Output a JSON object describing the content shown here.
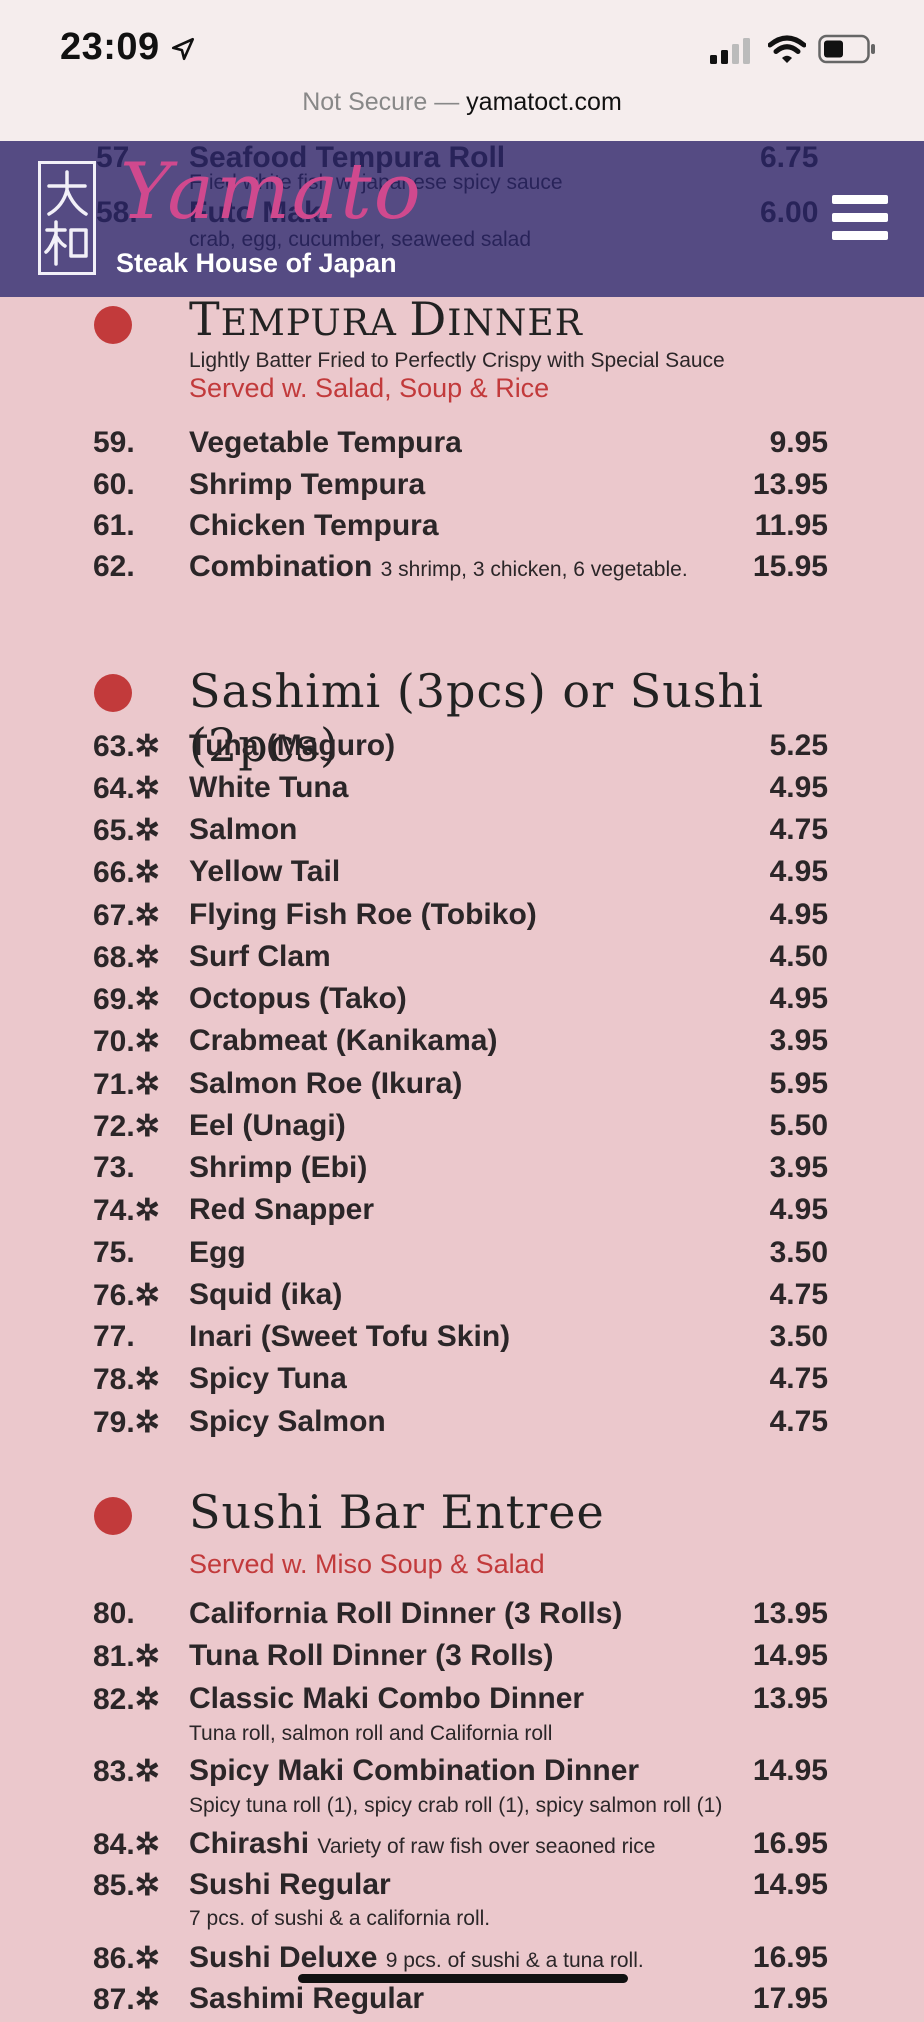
{
  "status_bar": {
    "time": "23:09",
    "url_prefix": "Not Secure — ",
    "url_host": "yamatoct.com"
  },
  "header": {
    "logo_script": "Yamato",
    "logo_subtitle": "Steak House of Japan",
    "under_rows": [
      {
        "num": "57.",
        "name": "Seafood Tempura Roll",
        "price": "6.75",
        "desc": "Fried white fish w. japanese spicy sauce"
      },
      {
        "num": "58.",
        "name": "Futo Maki",
        "price": "6.00",
        "desc": "crab, egg, cucumber, seaweed salad"
      }
    ],
    "menu_icon": "hamburger-menu-icon"
  },
  "sections": {
    "tempura": {
      "title_a": "T",
      "title_b": "EMPURA ",
      "title_c": "D",
      "title_d": "INNER",
      "subtitle": "Lightly Batter Fried to Perfectly Crispy with Special Sauce",
      "served": "Served w. Salad, Soup & Rice",
      "items": [
        {
          "num": "59.",
          "name": "Vegetable Tempura",
          "note": "",
          "price": "9.95"
        },
        {
          "num": "60.",
          "name": "Shrimp Tempura",
          "note": "",
          "price": "13.95"
        },
        {
          "num": "61.",
          "name": "Chicken Tempura",
          "note": "",
          "price": "11.95"
        },
        {
          "num": "62.",
          "name": "Combination ",
          "note": "3 shrimp, 3 chicken, 6 vegetable.",
          "price": "15.95"
        }
      ]
    },
    "sashimi": {
      "title": "Sashimi (3pcs) or Sushi (2pcs)",
      "items": [
        {
          "num": "63.✲",
          "name": "Tuna (Maguro)",
          "price": "5.25"
        },
        {
          "num": "64.✲",
          "name": "White Tuna",
          "price": "4.95"
        },
        {
          "num": "65.✲",
          "name": "Salmon",
          "price": "4.75"
        },
        {
          "num": "66.✲",
          "name": "Yellow Tail",
          "price": "4.95"
        },
        {
          "num": "67.✲",
          "name": "Flying Fish Roe (Tobiko)",
          "price": "4.95"
        },
        {
          "num": "68.✲",
          "name": "Surf Clam",
          "price": "4.50"
        },
        {
          "num": "69.✲",
          "name": "Octopus (Tako)",
          "price": "4.95"
        },
        {
          "num": "70.✲",
          "name": "Crabmeat (Kanikama)",
          "price": "3.95"
        },
        {
          "num": "71.✲",
          "name": "Salmon Roe (Ikura)",
          "price": "5.95"
        },
        {
          "num": "72.✲",
          "name": "Eel (Unagi)",
          "price": "5.50"
        },
        {
          "num": "73.",
          "name": "Shrimp (Ebi)",
          "price": "3.95"
        },
        {
          "num": "74.✲",
          "name": "Red Snapper",
          "price": "4.95"
        },
        {
          "num": "75.",
          "name": "Egg",
          "price": "3.50"
        },
        {
          "num": "76.✲",
          "name": "Squid (ika)",
          "price": "4.75"
        },
        {
          "num": "77.",
          "name": "Inari (Sweet Tofu Skin)",
          "price": "3.50"
        },
        {
          "num": "78.✲",
          "name": "Spicy Tuna",
          "price": "4.75"
        },
        {
          "num": "79.✲",
          "name": "Spicy Salmon",
          "price": "4.75"
        }
      ]
    },
    "sushi_bar": {
      "title": "Sushi Bar Entree",
      "served": "Served w. Miso Soup & Salad",
      "items": [
        {
          "num": "80.",
          "name": "California Roll Dinner (3 Rolls)",
          "note": "",
          "price": "13.95",
          "desc": ""
        },
        {
          "num": "81.✲",
          "name": "Tuna Roll Dinner (3 Rolls)",
          "note": "",
          "price": "14.95",
          "desc": ""
        },
        {
          "num": "82.✲",
          "name": "Classic Maki Combo Dinner",
          "note": "",
          "price": "13.95",
          "desc": "Tuna roll, salmon roll and California roll"
        },
        {
          "num": "83.✲",
          "name": "Spicy Maki Combination Dinner",
          "note": "",
          "price": "14.95",
          "desc": "Spicy tuna roll (1), spicy crab roll (1), spicy salmon roll (1)"
        },
        {
          "num": "84.✲",
          "name": "Chirashi ",
          "note": "Variety of raw fish over seaoned rice",
          "price": "16.95",
          "desc": ""
        },
        {
          "num": "85.✲",
          "name": "Sushi Regular",
          "note": "",
          "price": "14.95",
          "desc": "7 pcs. of sushi & a  california roll."
        },
        {
          "num": "86.✲",
          "name": "Sushi Deluxe ",
          "note": "9 pcs. of sushi & a tuna roll.",
          "price": "16.95",
          "desc": ""
        },
        {
          "num": "87.✲",
          "name": "Sashimi Regular",
          "note": "",
          "price": "17.95",
          "desc": ""
        }
      ]
    }
  },
  "colors": {
    "page_bg": "#ebc8cc",
    "header_bg": "#48407d",
    "accent_red": "#c23a3b",
    "logo_pink": "#d0498e"
  }
}
